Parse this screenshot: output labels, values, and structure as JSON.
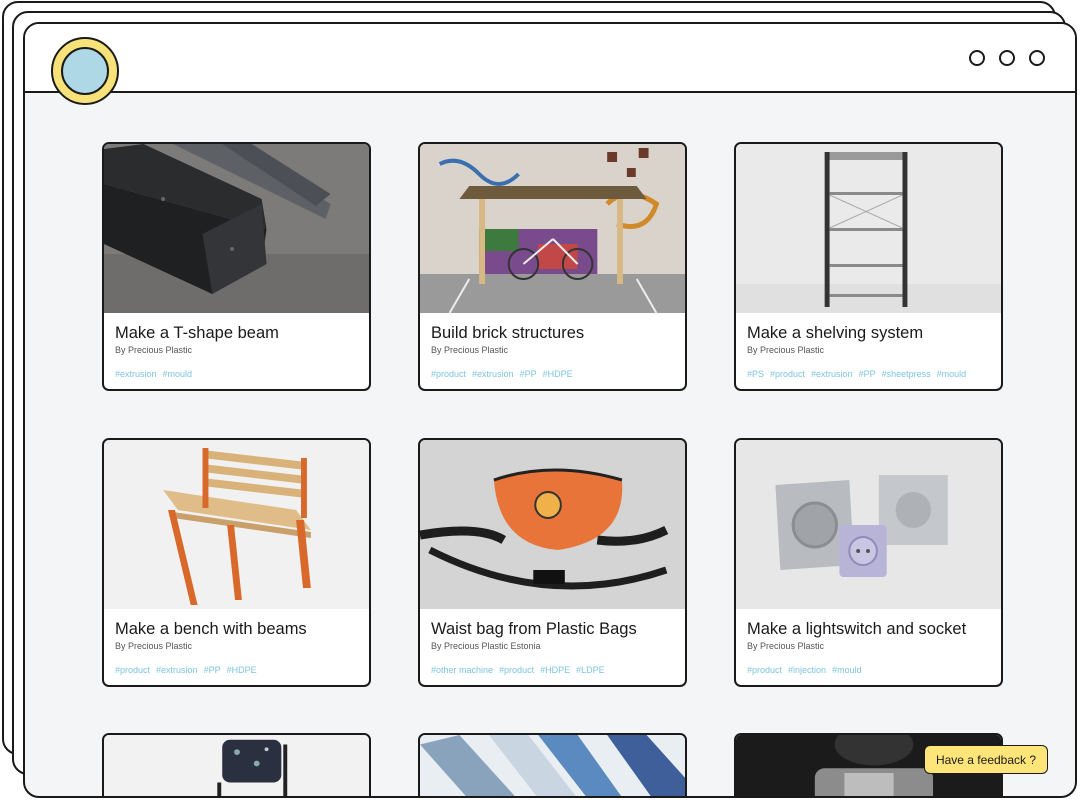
{
  "feedback_label": "Have a feedback ?",
  "cards": [
    {
      "title": "Make a T-shape beam",
      "author": "By Precious Plastic",
      "tags": [
        "#extrusion",
        "#mould"
      ],
      "image": "t-shape-beam-photo"
    },
    {
      "title": "Build brick structures",
      "author": "By Precious Plastic",
      "tags": [
        "#product",
        "#extrusion",
        "#PP",
        "#HDPE"
      ],
      "image": "bike-shed-photo"
    },
    {
      "title": "Make a shelving system",
      "author": "By Precious Plastic",
      "tags": [
        "#PS",
        "#product",
        "#extrusion",
        "#PP",
        "#sheetpress",
        "#mould"
      ],
      "image": "shelving-photo"
    },
    {
      "title": "Make a bench with beams",
      "author": "By Precious Plastic",
      "tags": [
        "#product",
        "#extrusion",
        "#PP",
        "#HDPE"
      ],
      "image": "bench-photo"
    },
    {
      "title": "Waist bag from Plastic Bags",
      "author": "By Precious Plastic Estonia",
      "tags": [
        "#other machine",
        "#product",
        "#HDPE",
        "#LDPE"
      ],
      "image": "waist-bag-photo"
    },
    {
      "title": "Make a lightswitch and socket",
      "author": "By Precious Plastic",
      "tags": [
        "#product",
        "#injection",
        "#mould"
      ],
      "image": "socket-mould-photo"
    }
  ],
  "partial_cards": [
    {
      "image": "chair-photo"
    },
    {
      "image": "plastic-beams-photo"
    },
    {
      "image": "worker-photo"
    }
  ],
  "colors": {
    "background": "#f3f5f7",
    "tag": "#7ec4e0",
    "feedback": "#fde57a",
    "logo_outer": "#f7e27a",
    "logo_inner": "#aed8e6"
  }
}
